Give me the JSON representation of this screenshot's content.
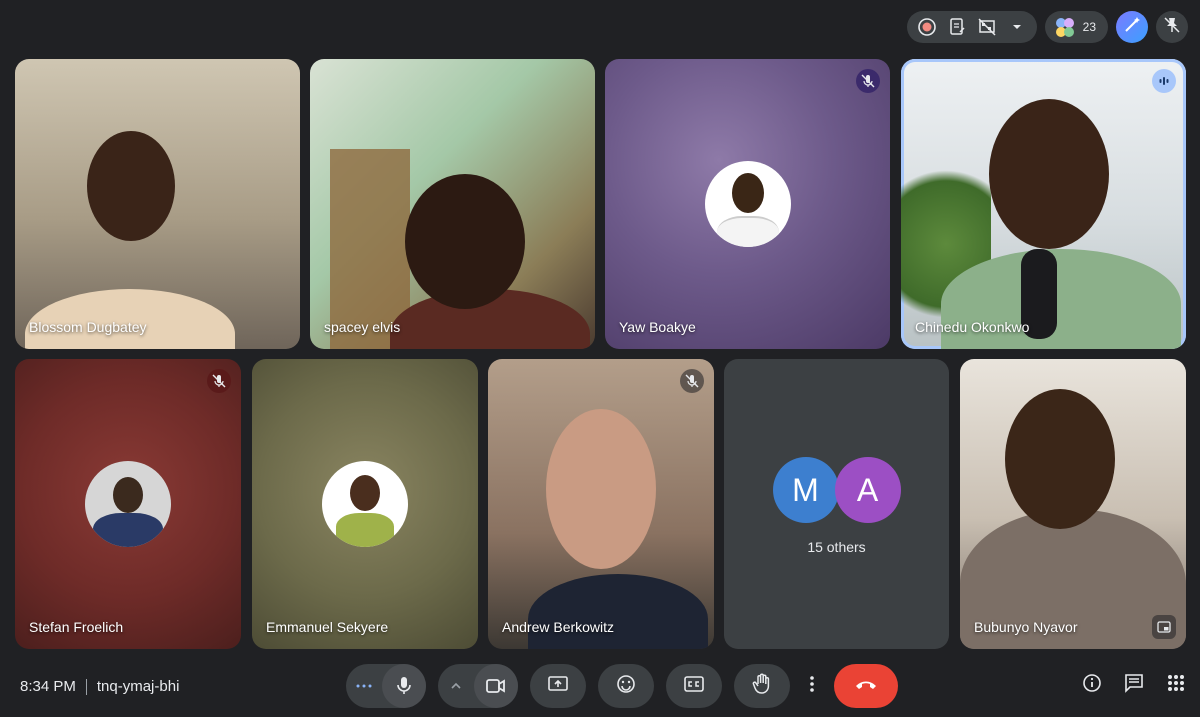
{
  "topbar": {
    "participant_count": "23",
    "icons": [
      "record-icon",
      "notes-icon",
      "no-present-icon",
      "chevron-down-icon",
      "participants-icon",
      "ai-sparkle-icon",
      "pin-off-icon"
    ]
  },
  "tiles": {
    "blossom": {
      "name": "Blossom Dugbatey"
    },
    "spacey": {
      "name": "spacey elvis"
    },
    "yaw": {
      "name": "Yaw Boakye",
      "muted": true
    },
    "chinedu": {
      "name": "Chinedu Okonkwo",
      "speaking": true
    },
    "stefan": {
      "name": "Stefan Froelich",
      "muted": true
    },
    "emmanuel": {
      "name": "Emmanuel Sekyere"
    },
    "andrew": {
      "name": "Andrew Berkowitz",
      "muted": true
    },
    "others": {
      "letters": [
        "M",
        "A"
      ],
      "label": "15 others"
    },
    "bubunyo": {
      "name": "Bubunyo Nyavor"
    }
  },
  "bottombar": {
    "time": "8:34 PM",
    "meeting_code": "tnq-ymaj-bhi"
  },
  "colors": {
    "background": "#202124",
    "end_call": "#ea4335",
    "active_border": "#a8c7fa"
  }
}
